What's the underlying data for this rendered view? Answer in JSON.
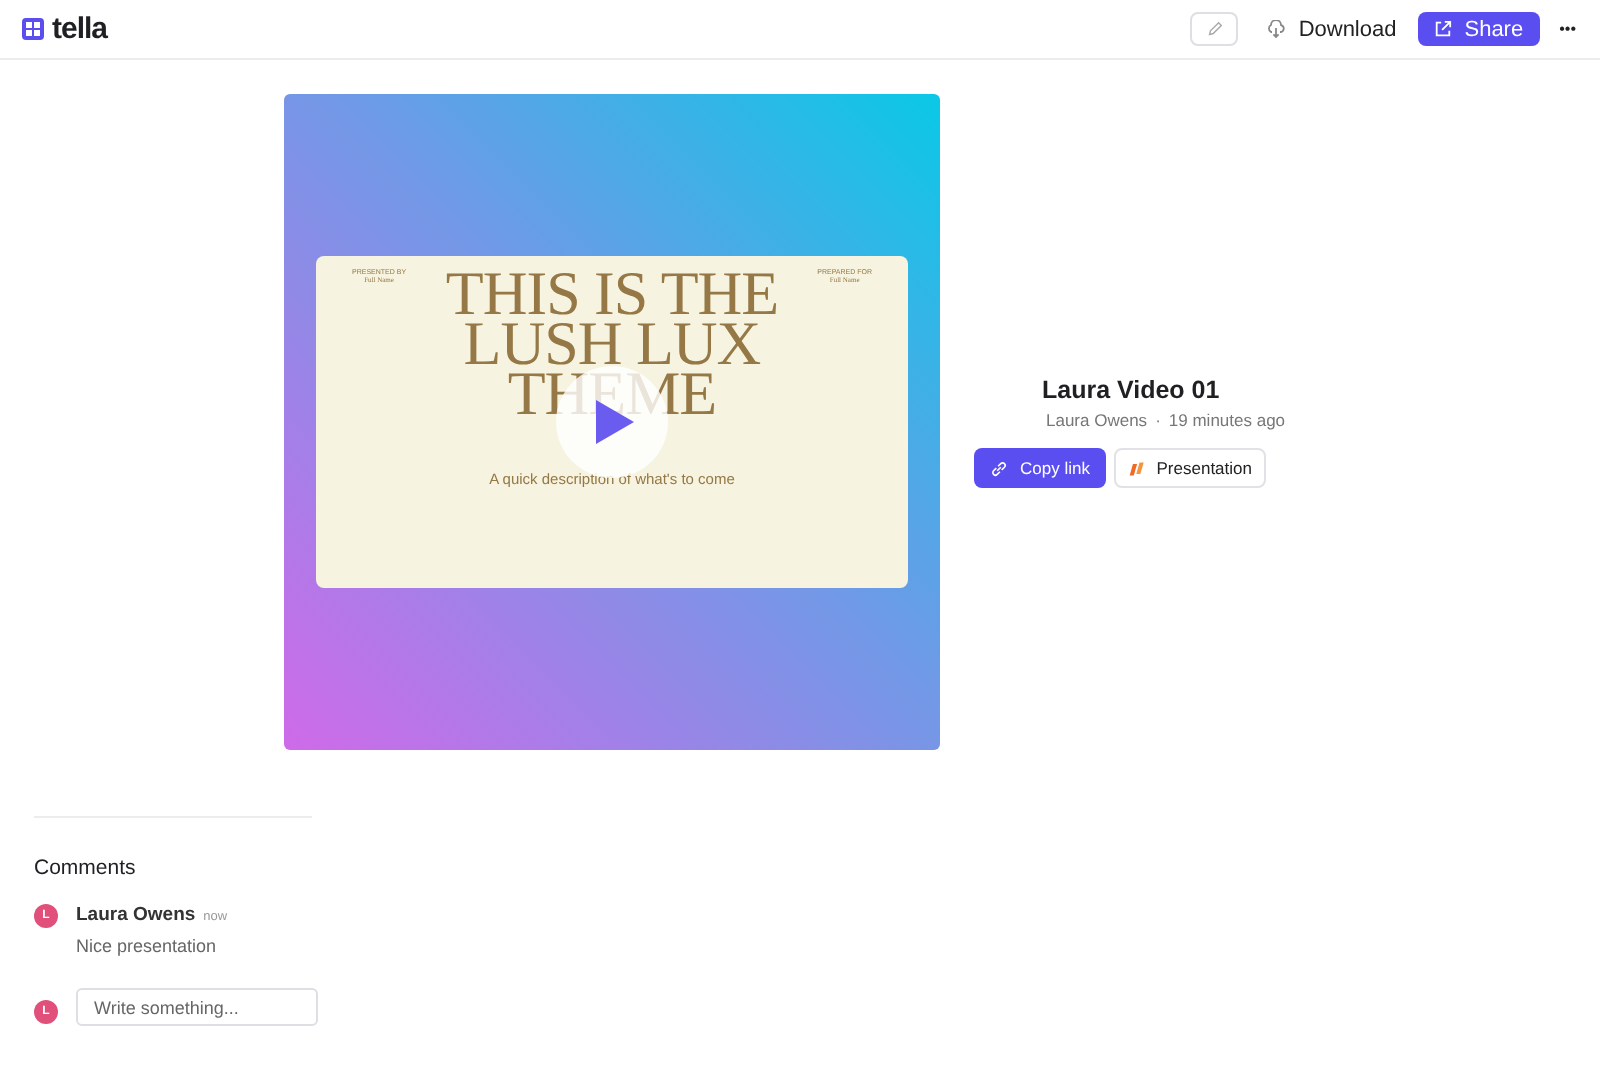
{
  "header": {
    "logo": "tella",
    "download": "Download",
    "share": "Share",
    "more": "•••"
  },
  "video": {
    "slide": {
      "presented_by_label": "PRESENTED BY",
      "presented_by_name": "Full Name",
      "prepared_for_label": "PREPARED FOR",
      "prepared_for_name": "Full Name",
      "title": "THIS IS THE LUSH LUX THEME",
      "description": "A quick description of what's to come"
    }
  },
  "info": {
    "title": "Laura Video 01",
    "author": "Laura Owens",
    "separator": "·",
    "time": "19 minutes ago",
    "copy_link": "Copy link",
    "presentation": "Presentation"
  },
  "comments": {
    "heading": "Comments",
    "items": [
      {
        "avatar": "L",
        "author": "Laura Owens",
        "time": "now",
        "text": "Nice presentation"
      }
    ],
    "input": {
      "avatar": "L",
      "placeholder": "Write something..."
    }
  }
}
